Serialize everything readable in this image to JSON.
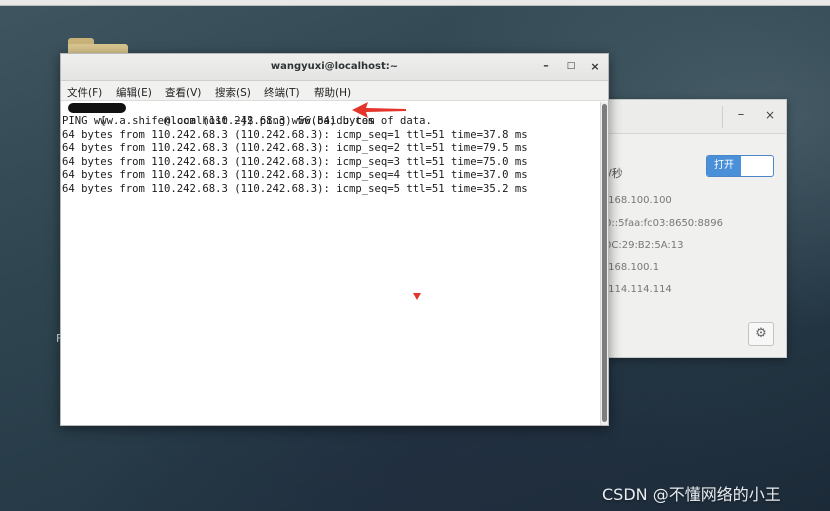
{
  "desktop": {
    "partial_label": "F"
  },
  "settings_window": {
    "minimize_label": "–",
    "close_label": "×",
    "rate_fragment": "b/秒",
    "toggle_label": "打开",
    "values": [
      ".168.100.100",
      "0::5faa:fc03:8650:8896",
      "0C:29:B2:5A:13",
      ".168.100.1",
      ".114.114.114"
    ]
  },
  "terminal": {
    "title": "wangyuxi@localhost:~",
    "minimize_label": "–",
    "maximize_label": "□",
    "close_label": "×",
    "menu": [
      "文件(F)",
      "编辑(E)",
      "查看(V)",
      "搜索(S)",
      "终端(T)",
      "帮助(H)"
    ],
    "prompt_line": "[         @localhost ~]$ ping www.baidu.com",
    "lines": [
      "PING www.a.shifen.com (110.242.68.3) 56(84) bytes of data.",
      "64 bytes from 110.242.68.3 (110.242.68.3): icmp_seq=1 ttl=51 time=37.8 ms",
      "64 bytes from 110.242.68.3 (110.242.68.3): icmp_seq=2 ttl=51 time=79.5 ms",
      "64 bytes from 110.242.68.3 (110.242.68.3): icmp_seq=3 ttl=51 time=75.0 ms",
      "64 bytes from 110.242.68.3 (110.242.68.3): icmp_seq=4 ttl=51 time=37.0 ms",
      "64 bytes from 110.242.68.3 (110.242.68.3): icmp_seq=5 ttl=51 time=35.2 ms"
    ]
  },
  "watermark": "CSDN @不懂网络的小王",
  "colors": {
    "annotation_red": "#e5342a",
    "toggle_blue": "#4a90d9"
  }
}
